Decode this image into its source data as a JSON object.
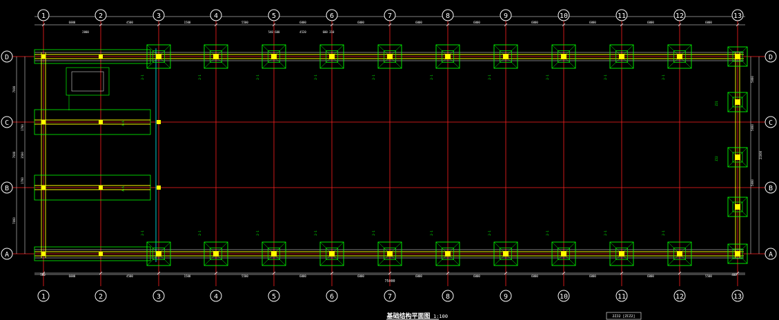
{
  "colors": {
    "background": "#000000",
    "axis_line": "#ff2020",
    "bubble": "#ffffff",
    "dimension": "#ffffff",
    "beam": "#ffff00",
    "footing": "#00ff00",
    "column": "#ffff00",
    "frame_line": "#ffffff",
    "cyan_line": "#00ffff",
    "annotation": "#00ff00"
  },
  "drawing": {
    "title": "基础结构平面图",
    "scale_text": "1:100",
    "small_note": "2ZJ2 [ZCZ2]"
  },
  "axes": {
    "columns": [
      "1",
      "2",
      "3",
      "4",
      "5",
      "6",
      "7",
      "8",
      "9",
      "10",
      "11",
      "12",
      "13"
    ],
    "rows": [
      "D",
      "C",
      "B",
      "A"
    ]
  },
  "dimensions": {
    "top_spans": [
      "6000",
      "4500",
      "1500",
      "5500",
      "6000",
      "6000",
      "6000",
      "6000",
      "6000",
      "6000",
      "6000",
      "6000",
      "5500"
    ],
    "top_detail": [
      "2000",
      "540 600",
      "4520",
      "600 310"
    ],
    "bottom_spans": [
      "6000",
      "4500",
      "1500",
      "5500",
      "6000",
      "6000",
      "6000",
      "6000",
      "6000",
      "6000",
      "6000",
      "5500",
      "6500"
    ],
    "overall": "75000",
    "left_spans": [
      "7000",
      "7000",
      "7000"
    ],
    "left_detail": [
      "1700",
      "3500",
      "1700"
    ],
    "right_spans": [
      "5000",
      "5000",
      "5000"
    ],
    "right_total": "21000",
    "edge_a": "500",
    "edge_b": "400"
  },
  "footing_labels": {
    "main": "2-1",
    "pad": "ZJ1",
    "pad_alt": "ZJ2",
    "beam": "A-A",
    "small": "1500"
  }
}
